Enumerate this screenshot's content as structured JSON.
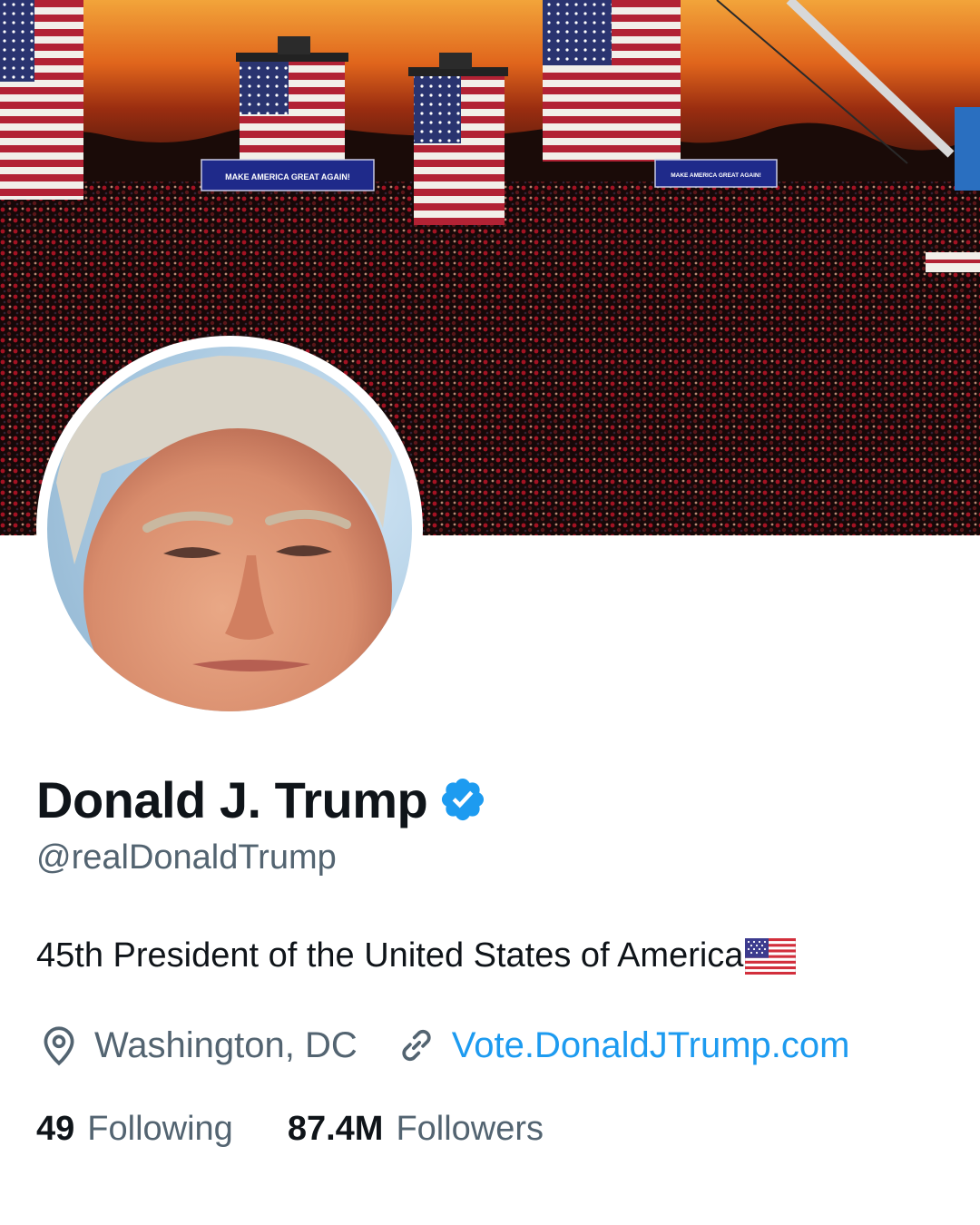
{
  "profile": {
    "display_name": "Donald J. Trump",
    "handle": "@realDonaldTrump",
    "bio": "45th President of the United States of America",
    "bio_emoji": "us-flag",
    "location": "Washington, DC",
    "website": "Vote.DonaldJTrump.com",
    "following_count": "49",
    "following_label": "Following",
    "followers_count": "87.4M",
    "followers_label": "Followers"
  },
  "banner": {
    "signs": [
      "MAKE AMERICA GREAT AGAIN!",
      "MAKE AMERICA GREAT AGAIN!"
    ]
  },
  "colors": {
    "text_primary": "#0f1419",
    "text_secondary": "#536471",
    "link": "#1d9bf0",
    "verified": "#1d9bf0"
  },
  "icons": {
    "verified": "verified-badge-icon",
    "location": "location-pin-icon",
    "link": "link-icon"
  }
}
